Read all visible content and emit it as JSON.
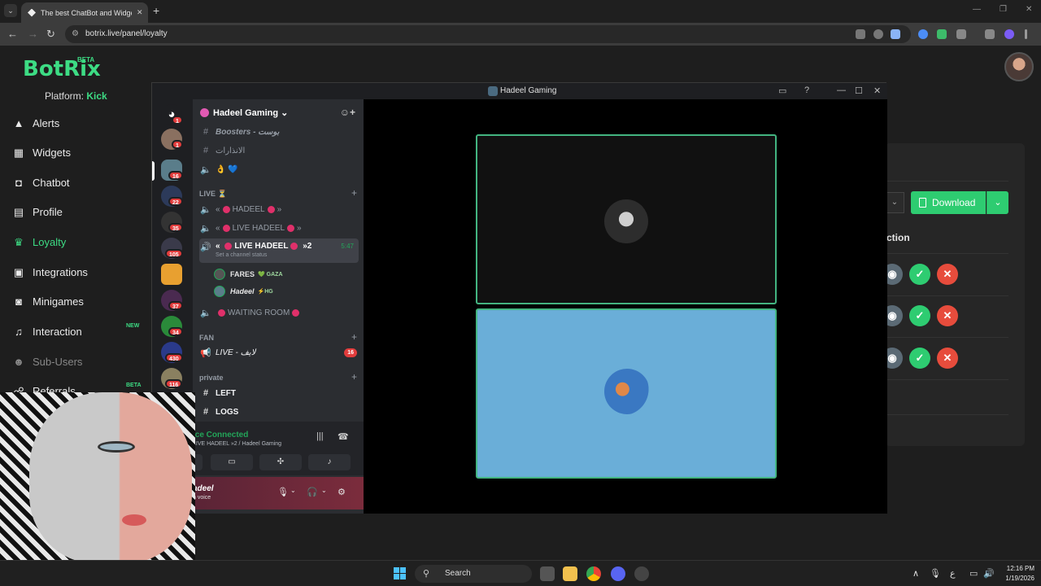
{
  "browser": {
    "tab_title": "The best ChatBot and Widgets",
    "tab_close": "✕",
    "new_tab": "+",
    "tab_search": "⌄",
    "url": "botrix.live/panel/loyalty",
    "win_min": "—",
    "win_max": "❐",
    "win_close": "✕"
  },
  "botrix": {
    "logo": "BotRix",
    "logo_badge": "BETA",
    "platform_label": "Platform:",
    "platform_value": "Kick",
    "nav": [
      {
        "label": "Alerts",
        "icon": "alert-icon"
      },
      {
        "label": "Widgets",
        "icon": "widgets-icon"
      },
      {
        "label": "Chatbot",
        "icon": "robot-icon"
      },
      {
        "label": "Profile",
        "icon": "profile-icon"
      },
      {
        "label": "Loyalty",
        "icon": "trophy-icon"
      },
      {
        "label": "Integrations",
        "icon": "integrations-icon"
      },
      {
        "label": "Minigames",
        "icon": "gamepad-icon"
      },
      {
        "label": "Interaction",
        "icon": "music-icon"
      },
      {
        "label": "Sub-Users",
        "icon": "users-icon"
      },
      {
        "label": "Referrals",
        "icon": "referrals-icon"
      }
    ],
    "new_badge": "NEW",
    "beta_badge": "BETA",
    "download_label": "Download",
    "action_header": "ction",
    "accent": "#3ddc84"
  },
  "discord": {
    "window_title": "Hadeel Gaming",
    "server_name": "Hadeel Gaming",
    "guild_badges": [
      "1",
      "1",
      "16",
      "22",
      "35",
      "105",
      "37",
      "34",
      "430",
      "116"
    ],
    "channels": {
      "boosters": "Boosters - بوست",
      "alerts": "الانذارات",
      "emoji_channel": "👌 💙",
      "cat_live": "LIVE ⏳",
      "live_1": "HADEEL",
      "live_2": "LIVE HADEEL",
      "live_3": "LIVE HADEEL",
      "live_3_count": "»2",
      "live_3_time": "5:47",
      "channel_status": "Set a channel status",
      "member_1": "FARES",
      "member_1_tag": "💚 GAZA",
      "member_2": "Hadeel",
      "member_2_tag": "⚡HG",
      "waiting_room": "WAITING ROOM",
      "cat_fan": "FAN",
      "fan_live": "LIVE - لايف",
      "fan_live_badge": "16",
      "cat_private": "private",
      "left": "LEFT",
      "logs": "LOGS"
    },
    "voice": {
      "status": "ice Connected",
      "detail": "LIVE HADEEL  »2 / Hadeel Gaming"
    },
    "user": {
      "name": "adeel",
      "status": "n voice"
    }
  },
  "taskbar": {
    "search": "Search",
    "time": "12:16 PM",
    "date": "1/19/2026",
    "lang": "ع"
  }
}
